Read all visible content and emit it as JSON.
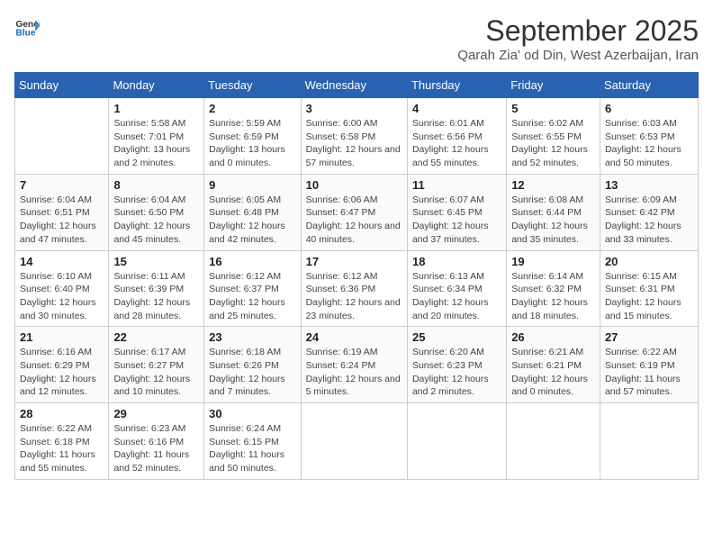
{
  "logo": {
    "text_general": "General",
    "text_blue": "Blue"
  },
  "title": "September 2025",
  "subtitle": "Qarah Zia' od Din, West Azerbaijan, Iran",
  "days_of_week": [
    "Sunday",
    "Monday",
    "Tuesday",
    "Wednesday",
    "Thursday",
    "Friday",
    "Saturday"
  ],
  "weeks": [
    [
      {
        "day": "",
        "sunrise": "",
        "sunset": "",
        "daylight": ""
      },
      {
        "day": "1",
        "sunrise": "Sunrise: 5:58 AM",
        "sunset": "Sunset: 7:01 PM",
        "daylight": "Daylight: 13 hours and 2 minutes."
      },
      {
        "day": "2",
        "sunrise": "Sunrise: 5:59 AM",
        "sunset": "Sunset: 6:59 PM",
        "daylight": "Daylight: 13 hours and 0 minutes."
      },
      {
        "day": "3",
        "sunrise": "Sunrise: 6:00 AM",
        "sunset": "Sunset: 6:58 PM",
        "daylight": "Daylight: 12 hours and 57 minutes."
      },
      {
        "day": "4",
        "sunrise": "Sunrise: 6:01 AM",
        "sunset": "Sunset: 6:56 PM",
        "daylight": "Daylight: 12 hours and 55 minutes."
      },
      {
        "day": "5",
        "sunrise": "Sunrise: 6:02 AM",
        "sunset": "Sunset: 6:55 PM",
        "daylight": "Daylight: 12 hours and 52 minutes."
      },
      {
        "day": "6",
        "sunrise": "Sunrise: 6:03 AM",
        "sunset": "Sunset: 6:53 PM",
        "daylight": "Daylight: 12 hours and 50 minutes."
      }
    ],
    [
      {
        "day": "7",
        "sunrise": "Sunrise: 6:04 AM",
        "sunset": "Sunset: 6:51 PM",
        "daylight": "Daylight: 12 hours and 47 minutes."
      },
      {
        "day": "8",
        "sunrise": "Sunrise: 6:04 AM",
        "sunset": "Sunset: 6:50 PM",
        "daylight": "Daylight: 12 hours and 45 minutes."
      },
      {
        "day": "9",
        "sunrise": "Sunrise: 6:05 AM",
        "sunset": "Sunset: 6:48 PM",
        "daylight": "Daylight: 12 hours and 42 minutes."
      },
      {
        "day": "10",
        "sunrise": "Sunrise: 6:06 AM",
        "sunset": "Sunset: 6:47 PM",
        "daylight": "Daylight: 12 hours and 40 minutes."
      },
      {
        "day": "11",
        "sunrise": "Sunrise: 6:07 AM",
        "sunset": "Sunset: 6:45 PM",
        "daylight": "Daylight: 12 hours and 37 minutes."
      },
      {
        "day": "12",
        "sunrise": "Sunrise: 6:08 AM",
        "sunset": "Sunset: 6:44 PM",
        "daylight": "Daylight: 12 hours and 35 minutes."
      },
      {
        "day": "13",
        "sunrise": "Sunrise: 6:09 AM",
        "sunset": "Sunset: 6:42 PM",
        "daylight": "Daylight: 12 hours and 33 minutes."
      }
    ],
    [
      {
        "day": "14",
        "sunrise": "Sunrise: 6:10 AM",
        "sunset": "Sunset: 6:40 PM",
        "daylight": "Daylight: 12 hours and 30 minutes."
      },
      {
        "day": "15",
        "sunrise": "Sunrise: 6:11 AM",
        "sunset": "Sunset: 6:39 PM",
        "daylight": "Daylight: 12 hours and 28 minutes."
      },
      {
        "day": "16",
        "sunrise": "Sunrise: 6:12 AM",
        "sunset": "Sunset: 6:37 PM",
        "daylight": "Daylight: 12 hours and 25 minutes."
      },
      {
        "day": "17",
        "sunrise": "Sunrise: 6:12 AM",
        "sunset": "Sunset: 6:36 PM",
        "daylight": "Daylight: 12 hours and 23 minutes."
      },
      {
        "day": "18",
        "sunrise": "Sunrise: 6:13 AM",
        "sunset": "Sunset: 6:34 PM",
        "daylight": "Daylight: 12 hours and 20 minutes."
      },
      {
        "day": "19",
        "sunrise": "Sunrise: 6:14 AM",
        "sunset": "Sunset: 6:32 PM",
        "daylight": "Daylight: 12 hours and 18 minutes."
      },
      {
        "day": "20",
        "sunrise": "Sunrise: 6:15 AM",
        "sunset": "Sunset: 6:31 PM",
        "daylight": "Daylight: 12 hours and 15 minutes."
      }
    ],
    [
      {
        "day": "21",
        "sunrise": "Sunrise: 6:16 AM",
        "sunset": "Sunset: 6:29 PM",
        "daylight": "Daylight: 12 hours and 12 minutes."
      },
      {
        "day": "22",
        "sunrise": "Sunrise: 6:17 AM",
        "sunset": "Sunset: 6:27 PM",
        "daylight": "Daylight: 12 hours and 10 minutes."
      },
      {
        "day": "23",
        "sunrise": "Sunrise: 6:18 AM",
        "sunset": "Sunset: 6:26 PM",
        "daylight": "Daylight: 12 hours and 7 minutes."
      },
      {
        "day": "24",
        "sunrise": "Sunrise: 6:19 AM",
        "sunset": "Sunset: 6:24 PM",
        "daylight": "Daylight: 12 hours and 5 minutes."
      },
      {
        "day": "25",
        "sunrise": "Sunrise: 6:20 AM",
        "sunset": "Sunset: 6:23 PM",
        "daylight": "Daylight: 12 hours and 2 minutes."
      },
      {
        "day": "26",
        "sunrise": "Sunrise: 6:21 AM",
        "sunset": "Sunset: 6:21 PM",
        "daylight": "Daylight: 12 hours and 0 minutes."
      },
      {
        "day": "27",
        "sunrise": "Sunrise: 6:22 AM",
        "sunset": "Sunset: 6:19 PM",
        "daylight": "Daylight: 11 hours and 57 minutes."
      }
    ],
    [
      {
        "day": "28",
        "sunrise": "Sunrise: 6:22 AM",
        "sunset": "Sunset: 6:18 PM",
        "daylight": "Daylight: 11 hours and 55 minutes."
      },
      {
        "day": "29",
        "sunrise": "Sunrise: 6:23 AM",
        "sunset": "Sunset: 6:16 PM",
        "daylight": "Daylight: 11 hours and 52 minutes."
      },
      {
        "day": "30",
        "sunrise": "Sunrise: 6:24 AM",
        "sunset": "Sunset: 6:15 PM",
        "daylight": "Daylight: 11 hours and 50 minutes."
      },
      {
        "day": "",
        "sunrise": "",
        "sunset": "",
        "daylight": ""
      },
      {
        "day": "",
        "sunrise": "",
        "sunset": "",
        "daylight": ""
      },
      {
        "day": "",
        "sunrise": "",
        "sunset": "",
        "daylight": ""
      },
      {
        "day": "",
        "sunrise": "",
        "sunset": "",
        "daylight": ""
      }
    ]
  ]
}
